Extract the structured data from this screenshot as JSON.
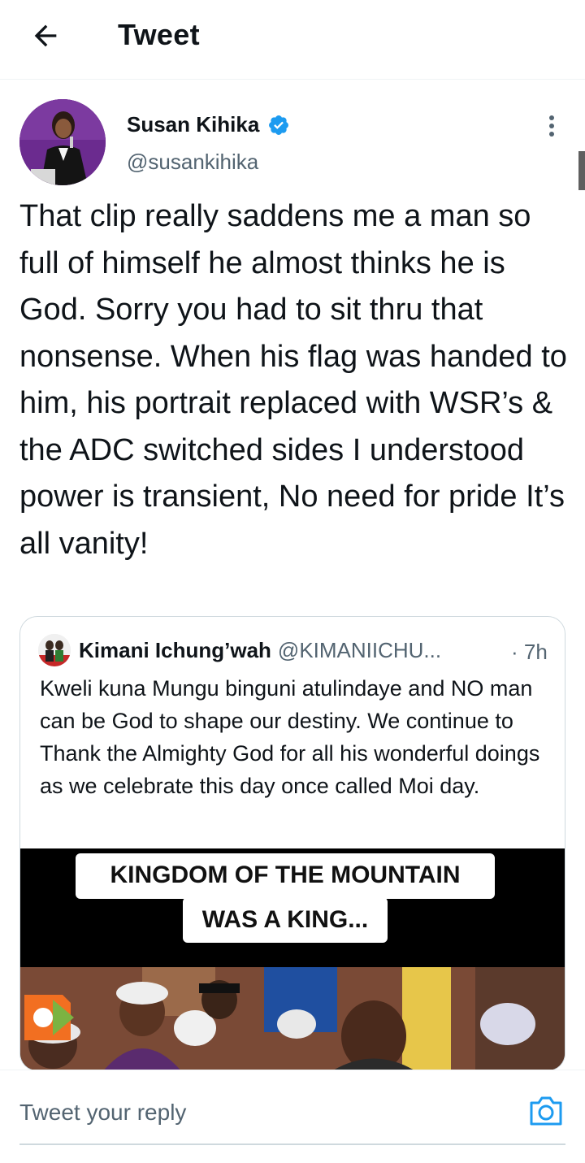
{
  "header": {
    "back_icon": "arrow-left-icon",
    "title": "Tweet"
  },
  "tweet": {
    "author_name": "Susan Kihika",
    "verified_icon": "verified-badge-icon",
    "handle": "@susankihika",
    "more_icon": "more-vertical-icon",
    "text": "That clip really saddens me a man so full of himself he almost thinks he is God. Sorry you had to sit thru that nonsense. When his flag was handed to him, his portrait replaced with WSR’s & the ADC switched sides I understood power is transient, No need for pride It’s all vanity!"
  },
  "quoted_tweet": {
    "author_name": "Kimani Ichung’wah",
    "handle": "@KIMANIICHU...",
    "time": "· 7h",
    "text": "Kweli kuna Mungu binguni atulindaye and NO man can be God to shape our destiny. We continue to Thank the Almighty God for all his wonderful doings as we celebrate this day once called Moi day.",
    "media": {
      "caption_line1": "KINGDOM OF THE MOUNTAIN",
      "caption_line2": "WAS A KING..."
    }
  },
  "reply": {
    "placeholder": "Tweet your reply",
    "camera_icon": "camera-icon"
  },
  "colors": {
    "accent": "#1d9bf0",
    "text": "#0f1419",
    "secondary": "#536471",
    "border": "#cfd9de"
  }
}
